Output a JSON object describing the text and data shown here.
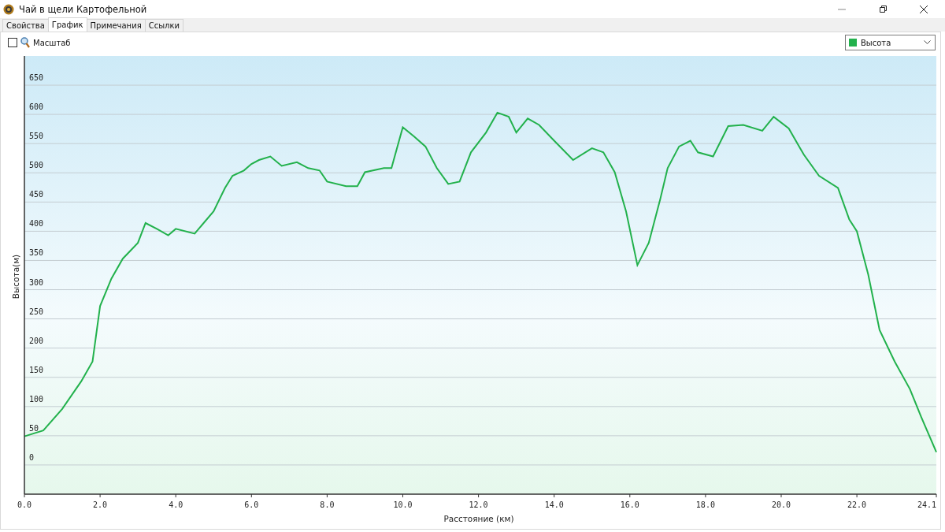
{
  "window": {
    "title": "Чай в щели Картофельной"
  },
  "tabs": [
    {
      "label": "Свойства",
      "selected": false
    },
    {
      "label": "График",
      "selected": true
    },
    {
      "label": "Примечания",
      "selected": false
    },
    {
      "label": "Ссылки",
      "selected": false
    }
  ],
  "toolbar": {
    "zoom_checkbox": {
      "label": "Масштаб",
      "checked": false
    }
  },
  "chart": {
    "chart_data": {
      "type": "line",
      "grid": true,
      "xlabel": "Расстояние (км)",
      "ylabel": "Высота(м)",
      "x": [
        0,
        0.5,
        1.0,
        1.5,
        1.8,
        2.0,
        2.3,
        2.6,
        3.0,
        3.2,
        3.5,
        3.8,
        4.0,
        4.5,
        5.0,
        5.3,
        5.5,
        5.8,
        6.0,
        6.2,
        6.5,
        6.8,
        7.2,
        7.5,
        7.8,
        8.0,
        8.5,
        8.8,
        9.0,
        9.5,
        9.7,
        10.0,
        10.3,
        10.6,
        10.9,
        11.2,
        11.5,
        11.8,
        12.2,
        12.5,
        12.8,
        13.0,
        13.3,
        13.6,
        14.0,
        14.5,
        15.0,
        15.3,
        15.6,
        15.9,
        16.2,
        16.5,
        16.8,
        17.0,
        17.3,
        17.6,
        17.8,
        18.2,
        18.6,
        19.0,
        19.5,
        19.8,
        20.2,
        20.6,
        21.0,
        21.5,
        21.8,
        22.0,
        22.3,
        22.6,
        23.0,
        23.4,
        23.7,
        24.1
      ],
      "series": [
        {
          "name": "Высота",
          "color": "#22b14c",
          "values": [
            49,
            59,
            96,
            143,
            177,
            272,
            319,
            353,
            380,
            414,
            404,
            393,
            404,
            396,
            434,
            474,
            495,
            504,
            515,
            522,
            528,
            512,
            518,
            508,
            504,
            485,
            477,
            477,
            501,
            508,
            508,
            578,
            562,
            545,
            508,
            481,
            485,
            535,
            569,
            603,
            596,
            569,
            593,
            582,
            555,
            522,
            542,
            535,
            501,
            434,
            342,
            380,
            454,
            508,
            545,
            555,
            535,
            528,
            580,
            582,
            572,
            596,
            576,
            531,
            495,
            474,
            420,
            400,
            326,
            231,
            177,
            130,
            82,
            22
          ]
        }
      ],
      "xlim": [
        0,
        24.1
      ],
      "ylim": [
        -50,
        700
      ],
      "xticks": [
        {
          "value": 0,
          "label": "0.0"
        },
        {
          "value": 2,
          "label": "2.0"
        },
        {
          "value": 4,
          "label": "4.0"
        },
        {
          "value": 6,
          "label": "6.0"
        },
        {
          "value": 8,
          "label": "8.0"
        },
        {
          "value": 10,
          "label": "10.0"
        },
        {
          "value": 12,
          "label": "12.0"
        },
        {
          "value": 14,
          "label": "14.0"
        },
        {
          "value": 16,
          "label": "16.0"
        },
        {
          "value": 18,
          "label": "18.0"
        },
        {
          "value": 20,
          "label": "20.0"
        },
        {
          "value": 22,
          "label": "22.0"
        },
        {
          "value": 24.1,
          "label": "24.1"
        }
      ],
      "yticks": [
        0,
        50,
        100,
        150,
        200,
        250,
        300,
        350,
        400,
        450,
        500,
        550,
        600,
        650
      ]
    }
  }
}
